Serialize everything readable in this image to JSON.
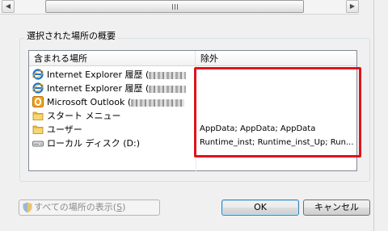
{
  "group_title": "選択された場所の概要",
  "columns": {
    "locations": "含まれる場所",
    "exclusions": "除外"
  },
  "locations": [
    {
      "icon": "internet-explorer-icon",
      "label": "Internet Explorer 履歴 ("
    },
    {
      "icon": "internet-explorer-icon",
      "label": "Internet Explorer 履歴 ("
    },
    {
      "icon": "outlook-icon",
      "label": "Microsoft Outlook ("
    },
    {
      "icon": "folder-icon",
      "label": "スタート メニュー"
    },
    {
      "icon": "folder-icon",
      "label": "ユーザー"
    },
    {
      "icon": "drive-icon",
      "label": "ローカル ディスク (D:)"
    }
  ],
  "exclusions": {
    "users": "AppData; AppData; AppData",
    "local_disk": "Runtime_inst; Runtime_inst_Up; Run..."
  },
  "buttons": {
    "show_all_prefix": "すべての場所の表示(",
    "show_all_key": "S",
    "show_all_suffix": ")",
    "ok": "OK",
    "cancel": "キャンセル"
  },
  "colors": {
    "highlight": "#e0131b",
    "window_bg": "#f0f0f0"
  }
}
